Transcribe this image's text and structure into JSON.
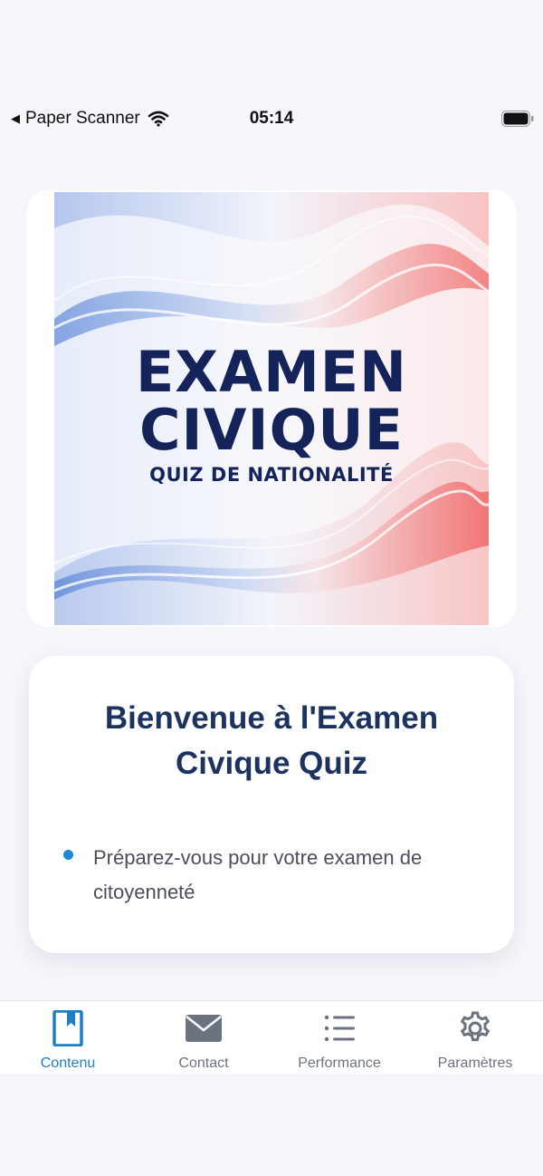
{
  "status_bar": {
    "back_app": "Paper Scanner",
    "time": "05:14"
  },
  "hero": {
    "title_line1": "EXAMEN",
    "title_line2": "CIVIQUE",
    "subtitle": "QUIZ DE NATIONALITÉ"
  },
  "welcome": {
    "title": "Bienvenue à l'Examen Civique Quiz",
    "bullets": [
      "Préparez-vous pour votre examen de citoyenneté"
    ]
  },
  "tabs": [
    {
      "label": "Contenu",
      "icon": "book-icon",
      "active": true
    },
    {
      "label": "Contact",
      "icon": "mail-icon",
      "active": false
    },
    {
      "label": "Performance",
      "icon": "list-icon",
      "active": false
    },
    {
      "label": "Paramètres",
      "icon": "gear-icon",
      "active": false
    }
  ],
  "colors": {
    "accent": "#1e7fc4",
    "title_navy": "#14245a",
    "heading": "#1c3360",
    "bullet": "#1e88d8",
    "inactive_tab": "#6b7280"
  }
}
